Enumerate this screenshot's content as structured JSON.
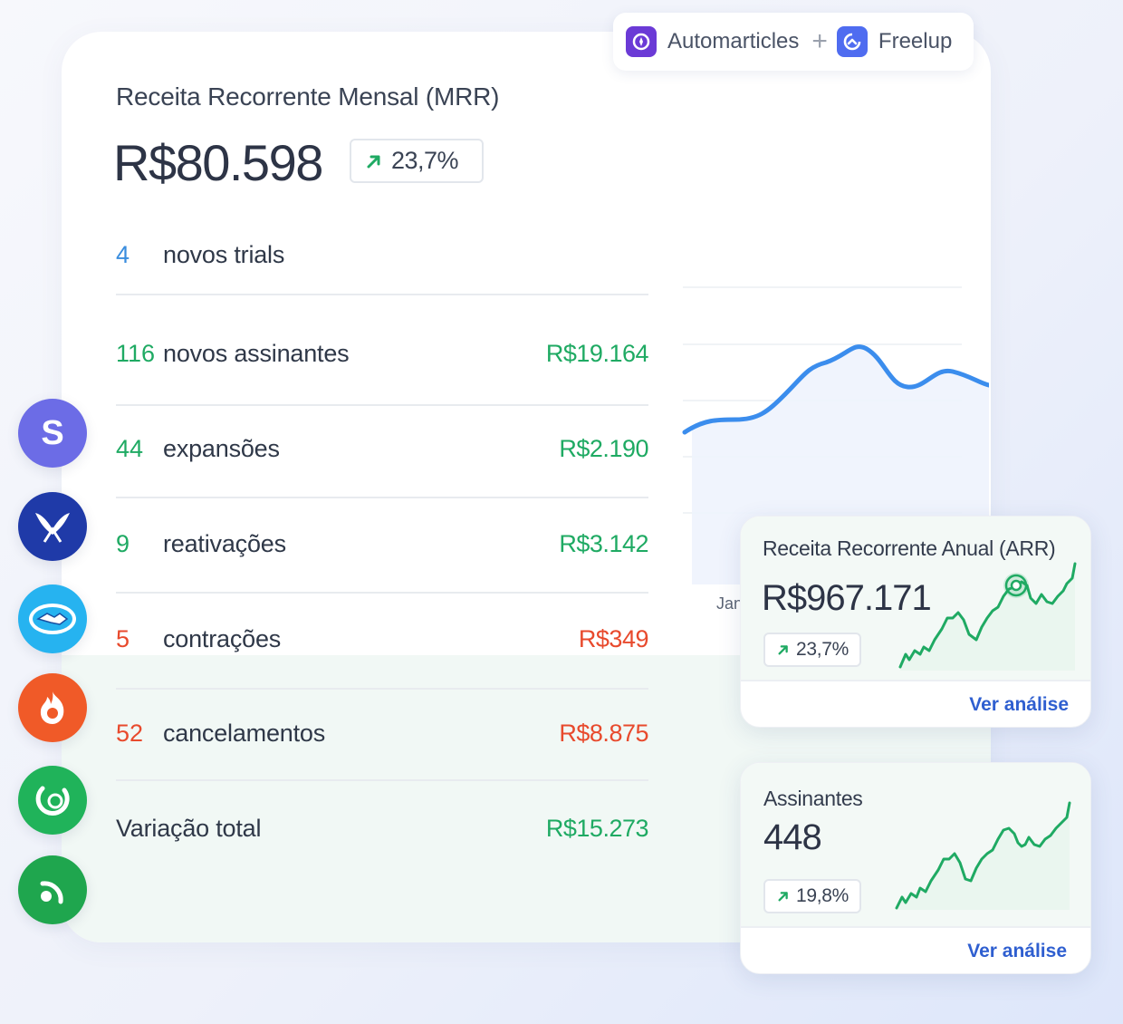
{
  "mrr": {
    "title": "Receita Recorrente Mensal (MRR)",
    "value": "R$80.598",
    "change": "23,7%",
    "chart_axis_label": "Jan"
  },
  "integration": {
    "app1": "Automarticles",
    "app2": "Freelup"
  },
  "metrics": [
    {
      "count": "4",
      "label": "novos trials",
      "amount": "",
      "color": "blue"
    },
    {
      "count": "116",
      "label": "novos assinantes",
      "amount": "R$19.164",
      "color": "green"
    },
    {
      "count": "44",
      "label": "expansões",
      "amount": "R$2.190",
      "color": "green"
    },
    {
      "count": "9",
      "label": "reativações",
      "amount": "R$3.142",
      "color": "green"
    },
    {
      "count": "5",
      "label": "contrações",
      "amount": "R$349",
      "color": "red"
    },
    {
      "count": "52",
      "label": "cancelamentos",
      "amount": "R$8.875",
      "color": "red"
    }
  ],
  "total": {
    "label": "Variação total",
    "amount": "R$15.273"
  },
  "arr_card": {
    "title": "Receita Recorrente Anual (ARR)",
    "value": "R$967.171",
    "change": "23,7%",
    "link": "Ver análise"
  },
  "subscribers_card": {
    "title": "Assinantes",
    "value": "448",
    "change": "19,8%",
    "link": "Ver análise"
  },
  "integrations_icons": [
    "stripe-icon",
    "eduzz-icon",
    "mercado-pago-icon",
    "hotmart-icon",
    "kiwify-icon",
    "greenn-icon"
  ],
  "colors": {
    "blue": "#3a8dde",
    "green": "#1faa63",
    "red": "#e84a2d",
    "link": "#2f5fd0"
  }
}
